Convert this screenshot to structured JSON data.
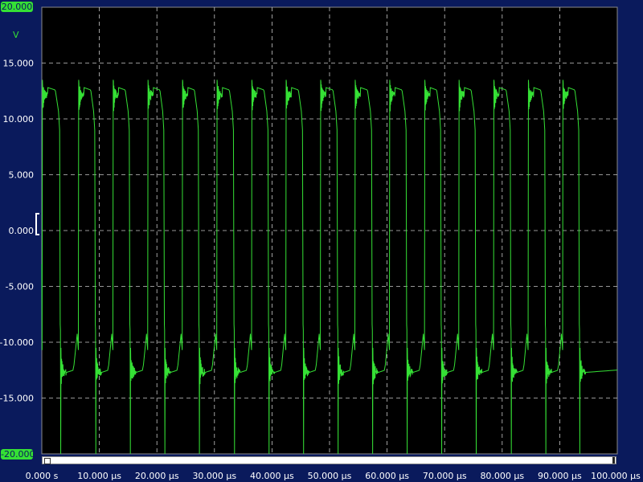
{
  "scope": {
    "y_max_badge": "20.000",
    "y_min_badge": "-20.000",
    "unit": "V"
  },
  "colors": {
    "background": "#0a1a5c",
    "plot_background": "#000000",
    "trace": "#35e035",
    "grid": "#c8c8c8",
    "label": "#ffffff"
  },
  "chart_data": {
    "type": "line",
    "ylabel": "V",
    "ylim": [
      -20,
      20
    ],
    "xlim_us": [
      0,
      100
    ],
    "grid": true,
    "y_ticks": [
      "15.000",
      "10.000",
      "5.000",
      "0.000",
      "-5.000",
      "-10.000",
      "-15.000"
    ],
    "y_tick_values": [
      15,
      10,
      5,
      0,
      -5,
      -10,
      -15
    ],
    "x_ticks": [
      "0.000 s",
      "10.000 µs",
      "20.000 µs",
      "30.000 µs",
      "40.000 µs",
      "50.000 µs",
      "60.000 µs",
      "70.000 µs",
      "80.000 µs",
      "90.000 µs",
      "100.000 µs"
    ],
    "x_tick_values_us": [
      0,
      10,
      20,
      30,
      40,
      50,
      60,
      70,
      80,
      90,
      100
    ],
    "series": [
      {
        "period_us": 6.0,
        "rise_times_us": [
          0.05,
          6.35,
          12.35,
          18.4,
          24.4,
          30.4,
          36.45,
          42.4,
          48.4,
          54.4,
          60.4,
          66.5,
          72.45,
          78.5,
          84.5,
          90.5
        ],
        "fall_times_us": [
          3.2,
          9.3,
          15.3,
          21.3,
          27.3,
          33.4,
          39.4,
          45.4,
          51.4,
          57.4,
          63.4,
          69.4,
          75.4,
          81.5,
          87.5,
          93.4
        ],
        "high_level_v": 12.8,
        "low_level_v": -12.7,
        "overshoot_peak_v": 13.5,
        "undershoot_peak_v": -20.0,
        "final_level_v": -12.5
      }
    ]
  }
}
